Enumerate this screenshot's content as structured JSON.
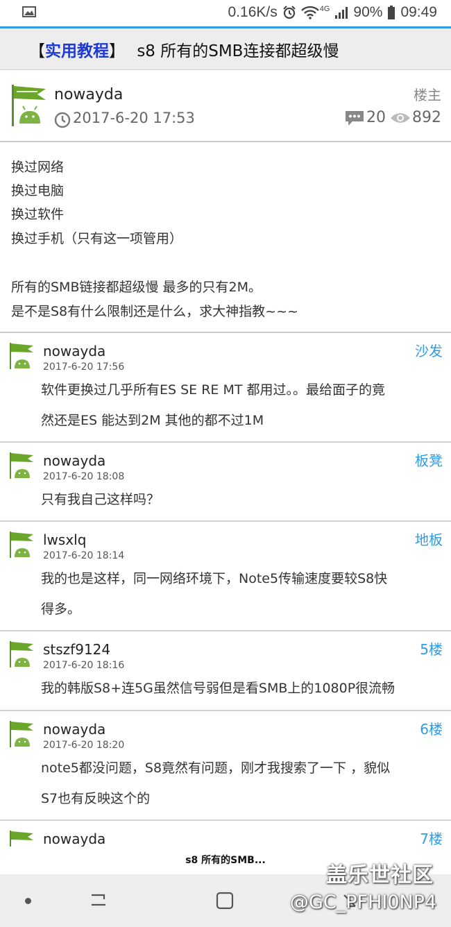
{
  "statusbar": {
    "speed": "0.16K/s",
    "network": "4G",
    "battery": "90%",
    "time": "09:49"
  },
  "thread": {
    "tag_open": "【",
    "tag": "实用教程",
    "tag_close": "】",
    "title": "s8 所有的SMB连接都超级慢"
  },
  "op": {
    "user": "nowayda",
    "date": "2017-6-20 17:53",
    "floor": "楼主",
    "replies": "20",
    "views": "892",
    "lines": [
      "换过网络",
      "换过电脑",
      "换过软件",
      "换过手机（只有这一项管用）",
      "所有的SMB链接都超级慢 最多的只有2M。",
      "是不是S8有什么限制还是什么，求大神指教~~~"
    ]
  },
  "replies": [
    {
      "user": "nowayda",
      "time": "2017-6-20 17:56",
      "floor": "沙发",
      "lines": [
        "软件更换过几乎所有ES SE RE MT 都用过。。最给面子的竟",
        "然还是ES 能达到2M 其他的都不过1M"
      ]
    },
    {
      "user": "nowayda",
      "time": "2017-6-20 18:08",
      "floor": "板凳",
      "lines": [
        "只有我自己这样吗？"
      ]
    },
    {
      "user": "lwsxlq",
      "time": "2017-6-20 18:14",
      "floor": "地板",
      "lines": [
        "我的也是这样，同一网络环境下，Note5传输速度要较S8快",
        "得多。"
      ]
    },
    {
      "user": "stszf9124",
      "time": "2017-6-20 18:16",
      "floor": "5楼",
      "lines": [
        "我的韩版S8+连5G虽然信号弱但是看SMB上的1080P很流畅"
      ]
    },
    {
      "user": "nowayda",
      "time": "2017-6-20 18:20",
      "floor": "6楼",
      "lines": [
        "note5都没问题，S8竟然有问题，刚才我搜索了一下 ，貌似",
        "S7也有反映这个的"
      ]
    },
    {
      "user": "nowayda",
      "time": "",
      "floor": "7楼",
      "lines": []
    }
  ],
  "bottom_tab": {
    "label": "s8 所有的SMB..."
  },
  "watermark": {
    "site": "盖乐世社区",
    "handle": "@GC_PFHI0NP4"
  },
  "colors": {
    "accent": "#2e9be6",
    "tag": "#1e3ad6"
  }
}
